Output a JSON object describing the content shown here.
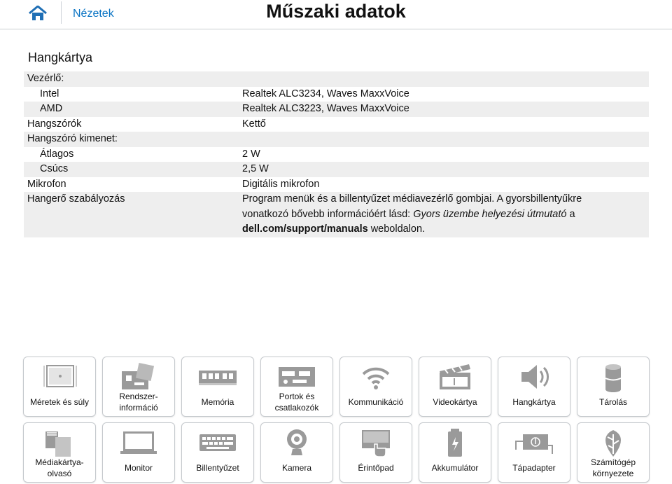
{
  "header": {
    "nav_label": "Nézetek",
    "title": "Műszaki adatok"
  },
  "section": {
    "title": "Hangkártya"
  },
  "specs": [
    {
      "label": "Vezérlő:",
      "value": "",
      "indent": false,
      "shade": true
    },
    {
      "label": "Intel",
      "value": "Realtek ALC3234, Waves MaxxVoice",
      "indent": true,
      "shade": false
    },
    {
      "label": "AMD",
      "value": "Realtek ALC3223, Waves MaxxVoice",
      "indent": true,
      "shade": true
    },
    {
      "label": "Hangszórók",
      "value": "Kettő",
      "indent": false,
      "shade": false
    },
    {
      "label": "Hangszóró kimenet:",
      "value": "",
      "indent": false,
      "shade": true
    },
    {
      "label": "Átlagos",
      "value": "2 W",
      "indent": true,
      "shade": false
    },
    {
      "label": "Csúcs",
      "value": "2,5 W",
      "indent": true,
      "shade": true
    },
    {
      "label": "Mikrofon",
      "value": "Digitális mikrofon",
      "indent": false,
      "shade": false
    }
  ],
  "volume_row": {
    "label": "Hangerő szabályozás",
    "text_part1": "Program menük és a billentyűzet médiavezérlő gombjai. A gyorsbillentyűkre vonatkozó bővebb információért lásd: ",
    "italic_part": "Gyors üzembe helyezési útmutató",
    "text_part2": " a ",
    "bold_part": "dell.com/support/manuals",
    "text_part3": " weboldalon."
  },
  "tiles": [
    {
      "label": "Méretek és súly",
      "icon": "dimensions-icon"
    },
    {
      "label": "Rendszer-\ninformáció",
      "icon": "system-board-icon"
    },
    {
      "label": "Memória",
      "icon": "memory-icon"
    },
    {
      "label": "Portok és\ncsatlakozók",
      "icon": "ports-icon"
    },
    {
      "label": "Kommunikáció",
      "icon": "wifi-icon"
    },
    {
      "label": "Videokártya",
      "icon": "clapperboard-icon"
    },
    {
      "label": "Hangkártya",
      "icon": "speaker-icon"
    },
    {
      "label": "Tárolás",
      "icon": "storage-icon"
    },
    {
      "label": "Médiakártya-\nolvasó",
      "icon": "media-card-icon"
    },
    {
      "label": "Monitor",
      "icon": "monitor-icon"
    },
    {
      "label": "Billentyűzet",
      "icon": "keyboard-icon"
    },
    {
      "label": "Kamera",
      "icon": "camera-icon"
    },
    {
      "label": "Érintőpad",
      "icon": "touchpad-icon"
    },
    {
      "label": "Akkumulátor",
      "icon": "battery-icon"
    },
    {
      "label": "Tápadapter",
      "icon": "power-adapter-icon"
    },
    {
      "label": "Számítógép\nkörnyezete",
      "icon": "environment-icon"
    }
  ],
  "colors": {
    "link": "#0a74c4",
    "home_icon": "#1f6fb5",
    "row_shade": "#eeeeee",
    "icon_gray": "#9a9a9a"
  }
}
